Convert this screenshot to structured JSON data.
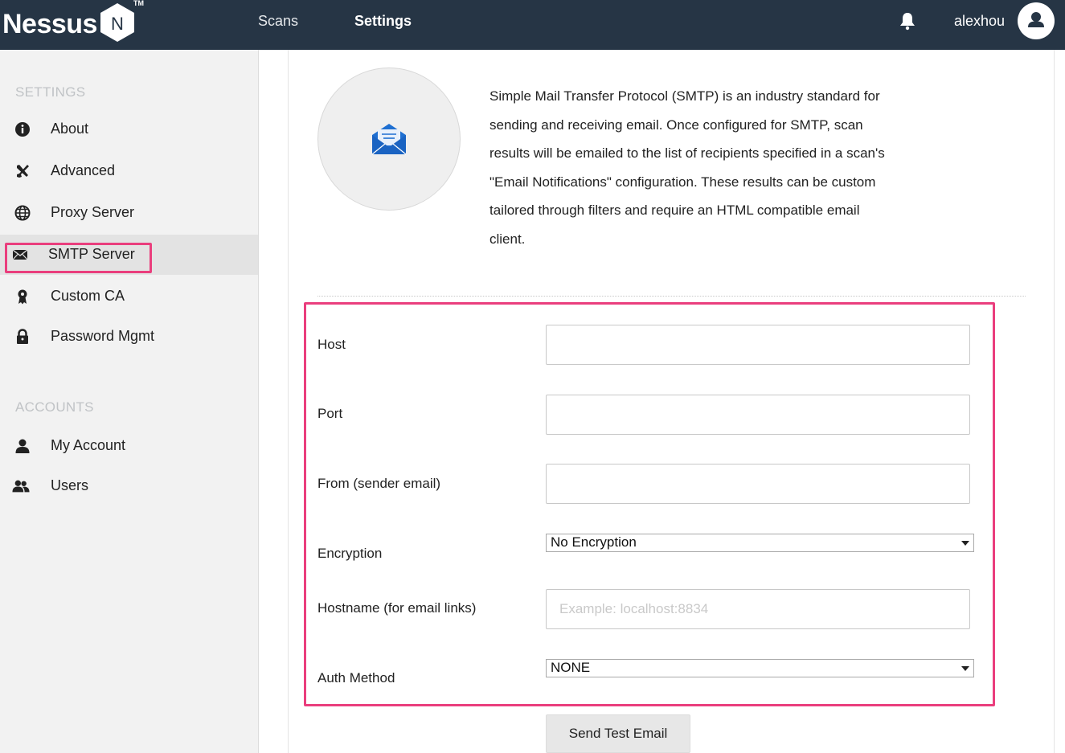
{
  "app": {
    "logo_text": "Nessus",
    "logo_badge_letter": "N",
    "logo_tm": "TM",
    "brand_color": "#263545",
    "accent_highlight": "#ea3e7d"
  },
  "topnav": {
    "items": [
      {
        "label": "Scans",
        "active": false
      },
      {
        "label": "Settings",
        "active": true
      }
    ],
    "notifications_icon": "bell-icon",
    "username": "alexhou",
    "avatar_icon": "user-icon"
  },
  "sidebar": {
    "settings_heading": "SETTINGS",
    "settings_items": [
      {
        "label": "About",
        "icon": "info-icon"
      },
      {
        "label": "Advanced",
        "icon": "tools-icon"
      },
      {
        "label": "Proxy Server",
        "icon": "globe-icon"
      },
      {
        "label": "SMTP Server",
        "icon": "envelope-icon",
        "active": true
      },
      {
        "label": "Custom CA",
        "icon": "certificate-icon"
      },
      {
        "label": "Password Mgmt",
        "icon": "lock-icon"
      }
    ],
    "accounts_heading": "ACCOUNTS",
    "accounts_items": [
      {
        "label": "My Account",
        "icon": "user-icon"
      },
      {
        "label": "Users",
        "icon": "users-icon"
      }
    ]
  },
  "main": {
    "hero_icon": "envelope-open-icon",
    "description_lines": [
      "Simple Mail Transfer Protocol (SMTP) is an industry standard for",
      "sending and receiving email. Once configured for SMTP, scan",
      "results will be emailed to the list of recipients specified in a scan's",
      "\"Email Notifications\" configuration. These results can be custom",
      "tailored through filters and require an HTML compatible email",
      "client."
    ],
    "form": {
      "host_label": "Host",
      "host_value": "",
      "port_label": "Port",
      "port_value": "",
      "from_label": "From (sender email)",
      "from_value": "",
      "encryption_label": "Encryption",
      "encryption_value": "No Encryption",
      "hostname_label": "Hostname (for email links)",
      "hostname_placeholder": "Example: localhost:8834",
      "auth_label": "Auth Method",
      "auth_value": "NONE"
    },
    "send_test_button": "Send Test Email"
  }
}
